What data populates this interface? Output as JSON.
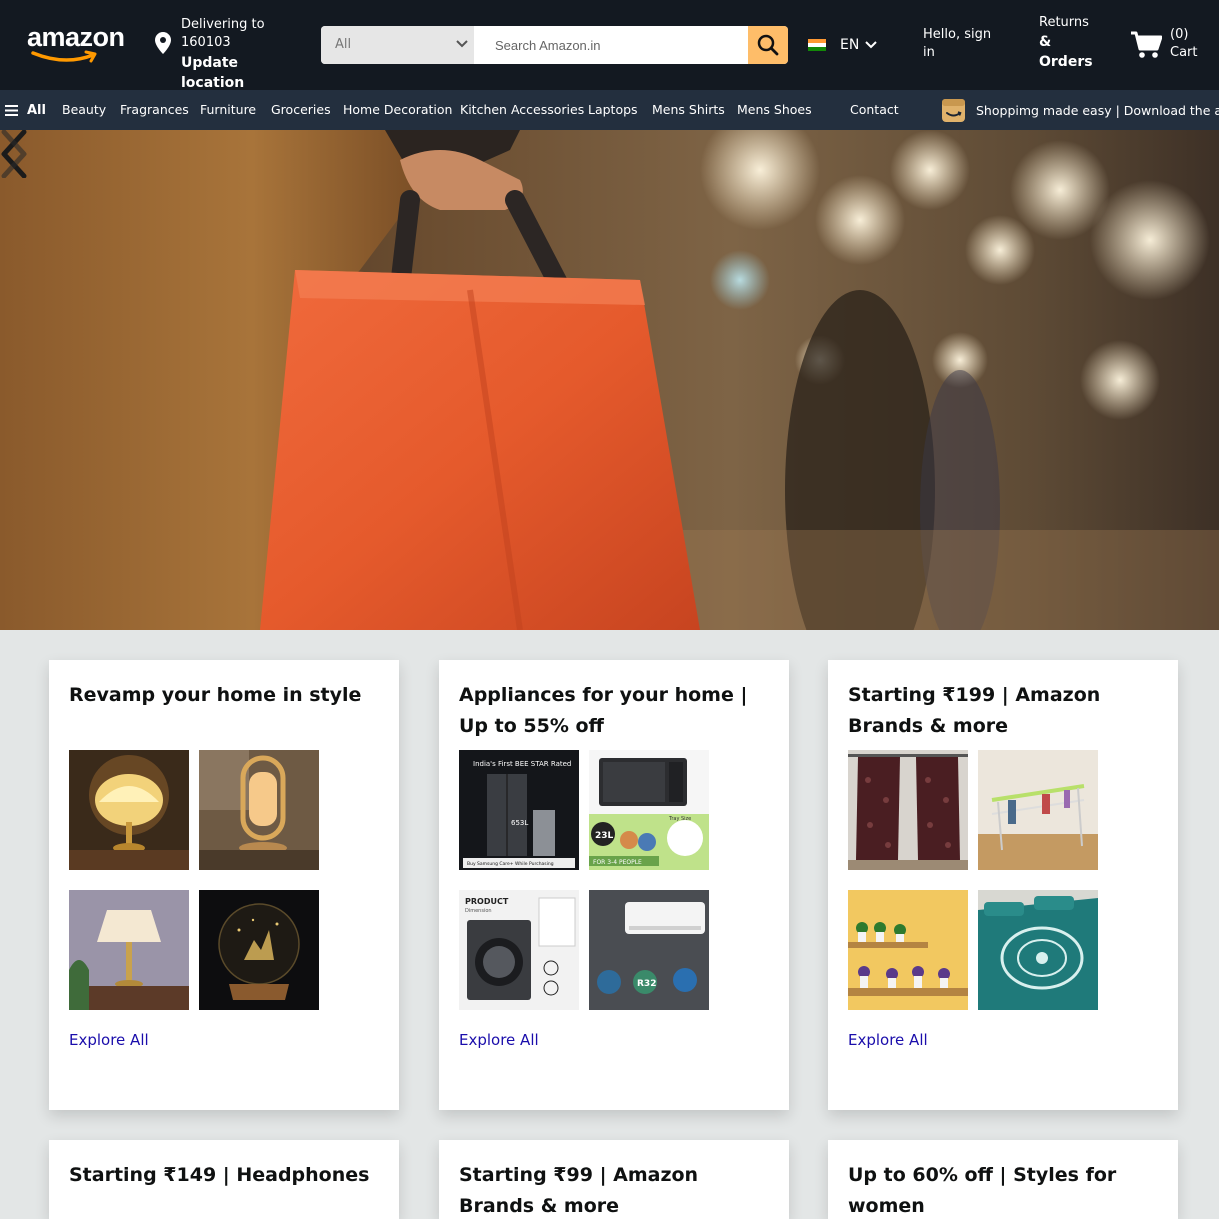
{
  "header": {
    "logo": "amazon",
    "deliver_line1": "Delivering to",
    "deliver_line2": "160103",
    "deliver_line3": "Update location",
    "search": {
      "category": "All",
      "placeholder": "Search Amazon.in"
    },
    "language": "EN",
    "signin": "Hello, sign in",
    "returns_line1": "Returns",
    "returns_line2": "&",
    "returns_line3": "Orders",
    "cart_count": "(0)",
    "cart_label": "Cart"
  },
  "nav": {
    "all_label": "All",
    "items": [
      "Beauty",
      "Fragrances",
      "Furniture",
      "Groceries",
      "Home Decoration",
      "Kitchen Accessories",
      "Laptops",
      "Mens Shirts",
      "Mens Shoes",
      "Contact"
    ],
    "promo": "Shoppimg made easy | Download the app"
  },
  "cards": [
    {
      "title": "Revamp your home in style",
      "explore": "Explore All",
      "images": [
        "table-lamp-icon",
        "ring-lamp-icon",
        "bedside-lamp-icon",
        "crystal-ball-lamp-icon"
      ]
    },
    {
      "title": "Appliances for your home | Up to 55% off",
      "explore": "Explore All",
      "images": [
        "refrigerator-icon",
        "microwave-icon",
        "washing-machine-icon",
        "air-conditioner-icon"
      ],
      "image_text": {
        "fridge_banner": "India's First BEE STAR Rated",
        "fridge_capacity": "653L",
        "fridge_footer": "Buy Samsung Care+ While Purchasing",
        "micro_capacity": "23L",
        "micro_people": "FOR 3-4 PEOPLE",
        "micro_tray": "Tray Size",
        "washer_banner": "PRODUCT",
        "washer_sub": "Dimension",
        "ac_badge": "R32"
      }
    },
    {
      "title": "Starting ₹199 | Amazon Brands & more",
      "explore": "Explore All",
      "images": [
        "curtains-icon",
        "cloth-dryer-icon",
        "plant-shelf-icon",
        "bedsheet-icon"
      ]
    },
    {
      "title": "Starting ₹149 | Headphones"
    },
    {
      "title": "Starting ₹99 | Amazon Brands & more"
    },
    {
      "title": "Up to 60% off | Styles for women"
    }
  ],
  "colors": {
    "header_bg": "#131921",
    "nav_bg": "#232f3e",
    "search_button": "#febd69",
    "link": "#1a0dab",
    "page_bg": "#e3e6e6"
  }
}
